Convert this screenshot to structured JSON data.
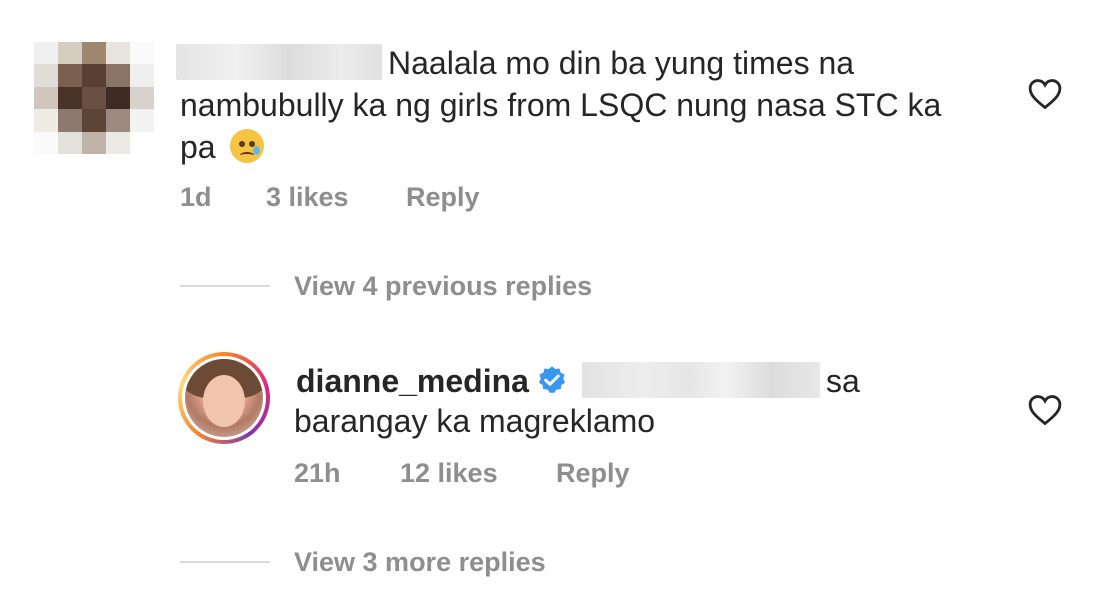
{
  "comments": [
    {
      "text_line1": "Naalala mo din ba yung times na",
      "text_line2": "nambubully ka ng girls from LSQC nung nasa STC ka",
      "text_line3": "pa",
      "emoji": "crying-face-emoji",
      "time": "1d",
      "likes": "3 likes",
      "reply": "Reply",
      "view_replies": "View 4 previous replies"
    },
    {
      "username": "dianne_medina",
      "verified_icon": "verified-badge-icon",
      "text_line1_suffix": "sa",
      "text_line2": "barangay ka magreklamo",
      "time": "21h",
      "likes": "12 likes",
      "reply": "Reply",
      "view_replies": "View 3 more replies"
    }
  ],
  "icons": {
    "heart": "heart-outline-icon"
  },
  "colors": {
    "text": "#262626",
    "meta": "#8e8e8e",
    "verified": "#3897f0"
  }
}
